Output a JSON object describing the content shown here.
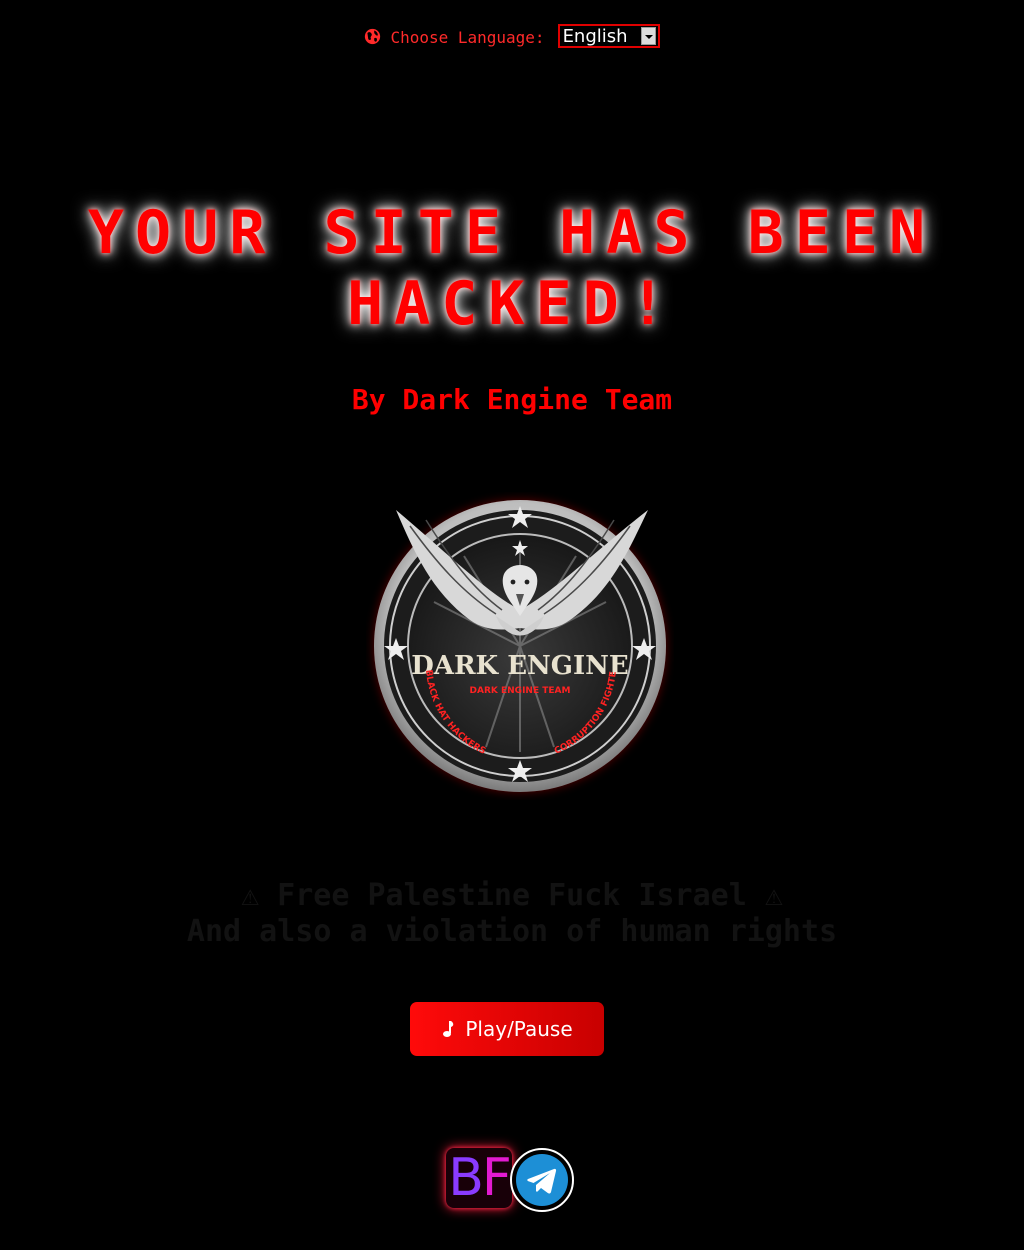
{
  "language_bar": {
    "label": "Choose Language:",
    "selected": "English",
    "icon": "globe-icon"
  },
  "headline": "YOUR SITE HAS BEEN HACKED!",
  "byline": "By Dark Engine Team",
  "emblem": {
    "title": "DARK ENGINE",
    "subtitle": "DARK ENGINE TEAM",
    "left_arc": "BLACK HAT HACKERS",
    "right_arc": "CORRUPTION FIGHTERS"
  },
  "message": {
    "line1": "⚠ Free Palestine Fuck Israel ⚠",
    "line2": "And also a violation of human rights"
  },
  "player": {
    "label": "Play/Pause",
    "icon": "music-note-icon"
  },
  "footer": {
    "badge_text_1": "B",
    "badge_text_2": "F",
    "telegram_icon": "telegram-icon"
  },
  "colors": {
    "background": "#000000",
    "accent": "#ff0000",
    "button": "#e00000"
  }
}
